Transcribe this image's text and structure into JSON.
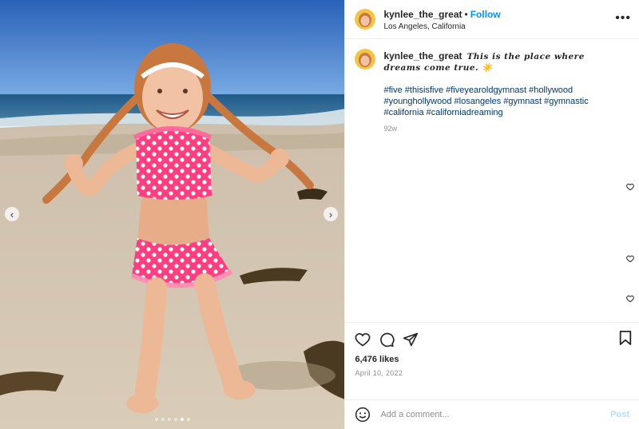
{
  "post": {
    "username": "kynlee_the_great",
    "separator": "•",
    "follow_label": "Follow",
    "location": "Los Angeles, California",
    "more_label": "•••",
    "caption_text": "𝑻𝒉𝒊𝒔 𝒊𝒔 𝒕𝒉𝒆 𝒑𝒍𝒂𝒄𝒆 𝒘𝒉𝒆𝒓𝒆 𝒅𝒓𝒆𝒂𝒎𝒔 𝒄𝒐𝒎𝒆 𝒕𝒓𝒖𝒆. ☀️",
    "hashtags": [
      "#five",
      "#thisisfive",
      "#fiveyearoldgymnast",
      "#hollywood",
      "#younghollywood",
      "#losangeles",
      "#gymnast",
      "#gymnastic",
      "#california",
      "#californiadreaming"
    ],
    "caption_age": "92w",
    "likes": "6,476 likes",
    "date": "April 10, 2022",
    "comment_placeholder": "Add a comment...",
    "post_label": "Post",
    "carousel": {
      "count": 6,
      "active_index": 4,
      "prev_label": "‹",
      "next_label": "›"
    }
  },
  "icons": {
    "like": "heart-icon",
    "comment": "comment-icon",
    "share": "share-icon",
    "save": "bookmark-icon",
    "emoji": "emoji-icon",
    "more": "more-options-icon",
    "comment_like": "heart-small-icon"
  },
  "colors": {
    "accent": "#0095f6",
    "hashtag": "#00376b",
    "muted": "#8e8e8e",
    "post_disabled": "#b2dffc"
  }
}
